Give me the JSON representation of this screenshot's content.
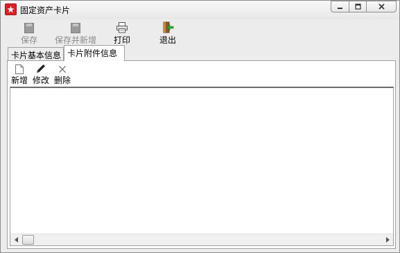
{
  "window": {
    "title": "固定资产卡片",
    "colors": {
      "app_icon": "#d8222a",
      "chrome": "#ececec",
      "panel": "#ffffff"
    }
  },
  "toolbar": {
    "save_label": "保存",
    "save_new_label": "保存并新增",
    "print_label": "打印",
    "exit_label": "退出"
  },
  "tabs": [
    {
      "label": "卡片基本信息",
      "active": false
    },
    {
      "label": "卡片附件信息",
      "active": true
    }
  ],
  "attachment_toolbar": {
    "add_label": "新增",
    "edit_label": "修改",
    "delete_label": "删除"
  },
  "icons": [
    "app-icon",
    "minimize-icon",
    "maximize-icon",
    "close-icon",
    "save-icon",
    "save-new-icon",
    "printer-icon",
    "exit-door-icon",
    "new-document-icon",
    "pencil-icon",
    "delete-x-icon",
    "scroll-left-icon",
    "scroll-right-icon"
  ]
}
